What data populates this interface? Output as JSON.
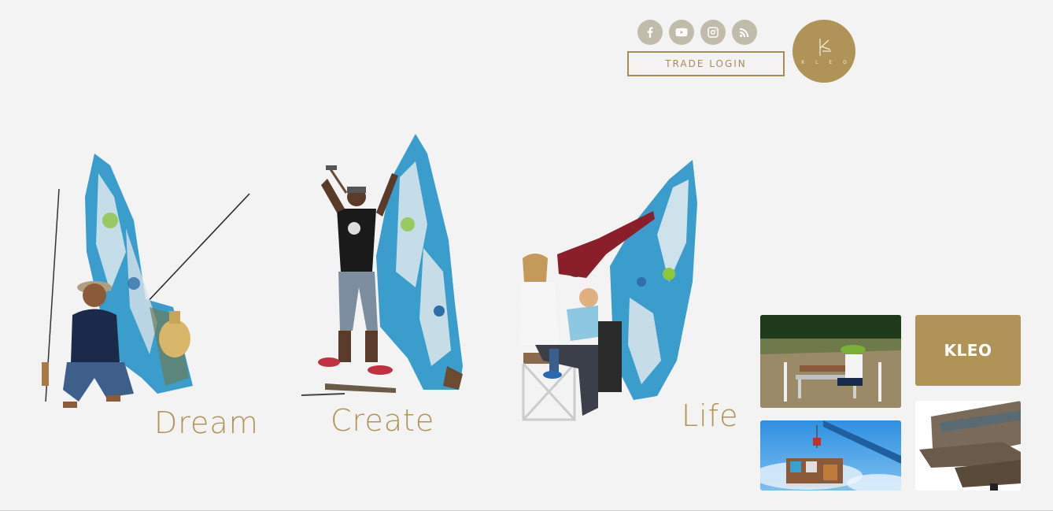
{
  "social": {
    "facebook": {
      "icon": "facebook-icon"
    },
    "youtube": {
      "icon": "youtube-icon"
    },
    "instagram": {
      "icon": "instagram-icon"
    },
    "rss": {
      "icon": "rss-icon"
    }
  },
  "header": {
    "trade_login": "TRADE LOGIN",
    "logo_text": "K L E O"
  },
  "scenes": {
    "dream": "Dream",
    "create": "Create",
    "life": "Life"
  },
  "tiles": {
    "kleo_label": "KLEO"
  },
  "colors": {
    "accent": "#b09356",
    "social_bg": "#c1bbac",
    "background": "#f3f3f3"
  }
}
